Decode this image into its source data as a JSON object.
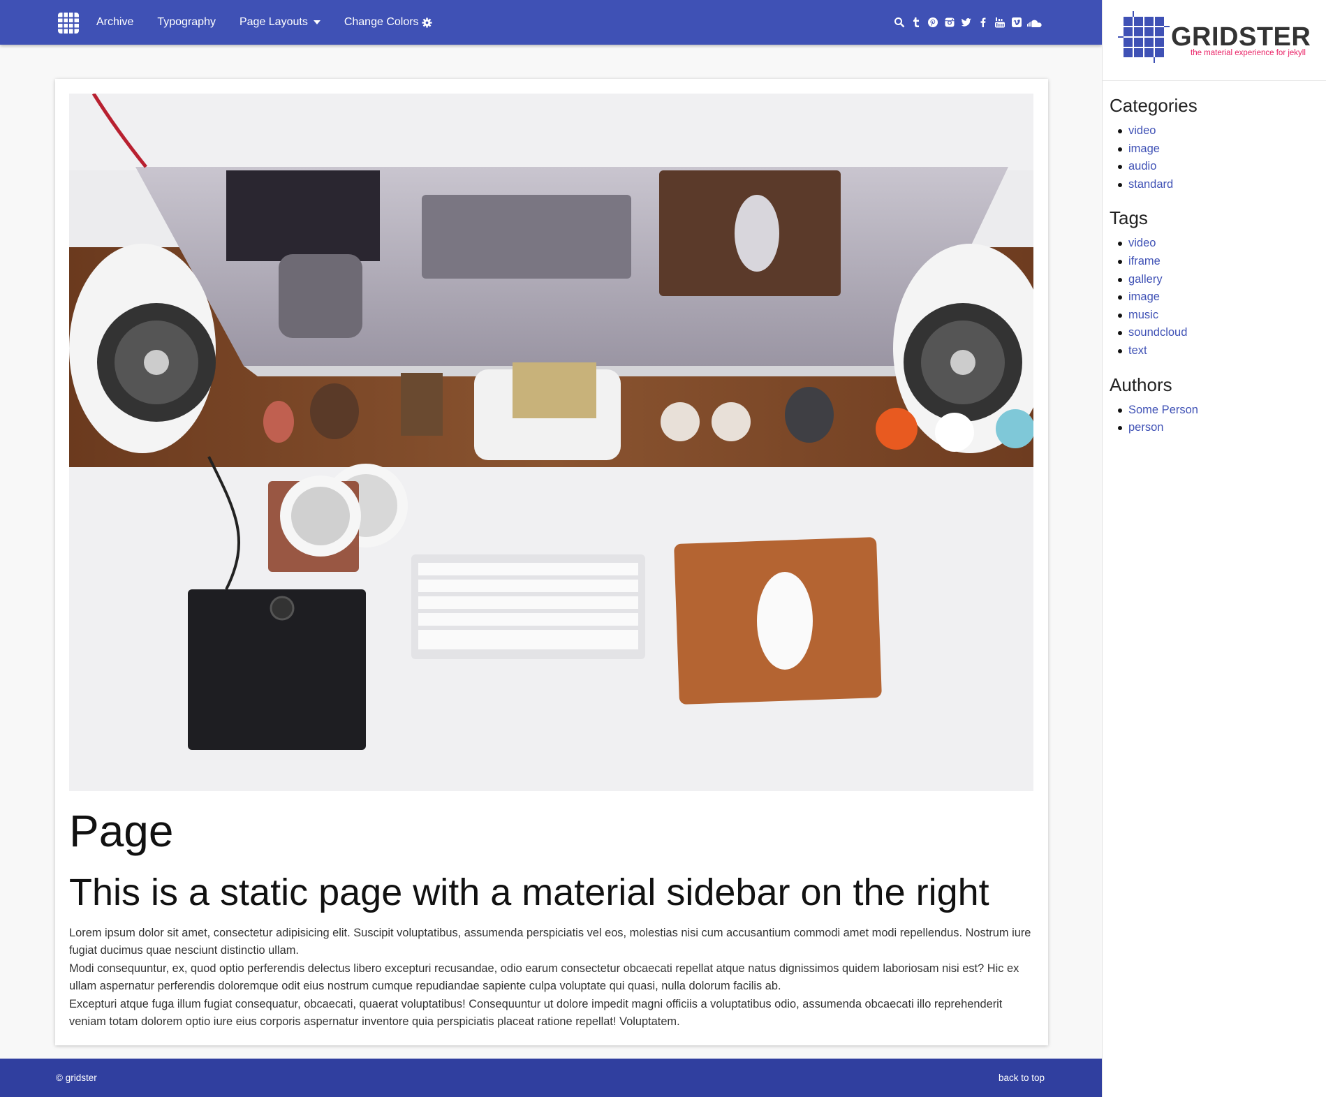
{
  "nav": {
    "items": [
      "Archive",
      "Typography",
      "Page Layouts",
      "Change Colors"
    ],
    "social_icons": [
      "search-icon",
      "tumblr-icon",
      "pinterest-icon",
      "instagram-icon",
      "twitter-icon",
      "facebook-icon",
      "youtube-icon",
      "vimeo-icon",
      "soundcloud-icon"
    ],
    "bar_color": "#3f51b5"
  },
  "sidebar": {
    "brand_name": "GRIDSTER",
    "brand_tagline": "the material experience for jekyll",
    "categories_title": "Categories",
    "categories": [
      "video",
      "image",
      "audio",
      "standard"
    ],
    "tags_title": "Tags",
    "tags": [
      "video",
      "iframe",
      "gallery",
      "image",
      "music",
      "soundcloud",
      "text"
    ],
    "authors_title": "Authors",
    "authors": [
      "Some Person",
      "person"
    ],
    "accent_color": "#e91e63",
    "link_color": "#3f51b5"
  },
  "main": {
    "hero_image": "desk-setup-photo",
    "title": "Page",
    "subtitle": "This is a static page with a material sidebar on the right",
    "paragraph_1": "Lorem ipsum dolor sit amet, consectetur adipisicing elit. Suscipit voluptatibus, assumenda perspiciatis vel eos, molestias nisi cum accusantium commodi amet modi repellendus. Nostrum iure fugiat ducimus quae nesciunt distinctio ullam.",
    "paragraph_2": "Modi consequuntur, ex, quod optio perferendis delectus libero excepturi recusandae, odio earum consectetur obcaecati repellat atque natus dignissimos quidem laboriosam nisi est? Hic ex ullam aspernatur perferendis doloremque odit eius nostrum cumque repudiandae sapiente culpa voluptate qui quasi, nulla dolorum facilis ab.",
    "paragraph_3": "Excepturi atque fuga illum fugiat consequatur, obcaecati, quaerat voluptatibus! Consequuntur ut dolore impedit magni officiis a voluptatibus odio, assumenda obcaecati illo reprehenderit veniam totam dolorem optio iure eius corporis aspernatur inventore quia perspiciatis placeat ratione repellat! Voluptatem."
  },
  "footer": {
    "copyright": "© gridster",
    "back_to_top": "back to top",
    "bar_color": "#303f9f"
  }
}
